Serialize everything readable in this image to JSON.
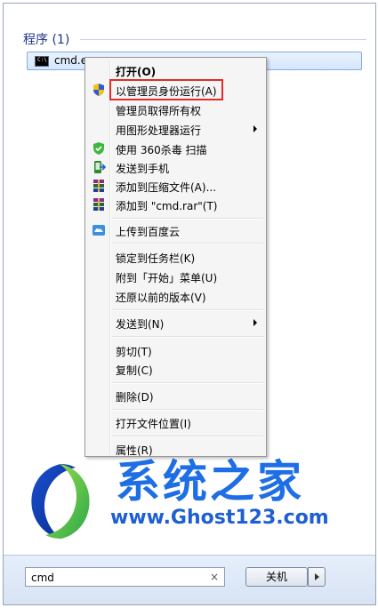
{
  "programs": {
    "header": "程序 (1)",
    "result": "cmd.exe",
    "result_icon": "cmd-console-icon"
  },
  "context_menu": {
    "items": [
      {
        "label": "打开(O)",
        "bold": true
      },
      {
        "label": "以管理员身份运行(A)",
        "icon": "uac-shield-icon",
        "highlighted": true
      },
      {
        "label": "管理员取得所有权"
      },
      {
        "label": "用图形处理器运行",
        "submenu": true
      },
      {
        "label": "使用 360杀毒 扫描",
        "icon": "360-shield-icon"
      },
      {
        "label": "发送到手机",
        "icon": "phone-send-icon"
      },
      {
        "label": "添加到压缩文件(A)...",
        "icon": "winrar-icon"
      },
      {
        "label": "添加到 \"cmd.rar\"(T)",
        "icon": "winrar-icon"
      },
      {
        "label": "上传到百度云",
        "icon": "baidu-cloud-icon"
      },
      {
        "label": "锁定到任务栏(K)"
      },
      {
        "label": "附到「开始」菜单(U)"
      },
      {
        "label": "还原以前的版本(V)"
      },
      {
        "label": "发送到(N)",
        "submenu": true
      },
      {
        "label": "剪切(T)"
      },
      {
        "label": "复制(C)"
      },
      {
        "label": "删除(D)"
      },
      {
        "label": "打开文件位置(I)"
      },
      {
        "label": "属性(R)"
      }
    ],
    "highlight_color": "#e32b2b"
  },
  "watermark": {
    "brand": "系统之家",
    "url": "www.Ghost123.com"
  },
  "search": {
    "value": "cmd",
    "clear_symbol": "×"
  },
  "shutdown": {
    "label": "关机"
  }
}
